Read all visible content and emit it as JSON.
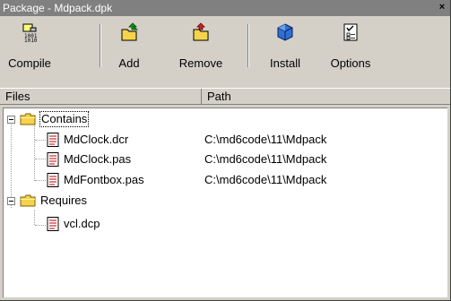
{
  "window": {
    "title": "Package - Mdpack.dpk",
    "close_glyph": "×"
  },
  "toolbar": {
    "compile_label": "Compile",
    "add_label": "Add",
    "remove_label": "Remove",
    "install_label": "Install",
    "options_label": "Options"
  },
  "columns": {
    "files": "Files",
    "path": "Path"
  },
  "tree": {
    "contains": {
      "label": "Contains",
      "files": [
        {
          "name": "MdClock.dcr",
          "path": "C:\\md6code\\11\\Mdpack"
        },
        {
          "name": "MdClock.pas",
          "path": "C:\\md6code\\11\\Mdpack"
        },
        {
          "name": "MdFontbox.pas",
          "path": "C:\\md6code\\11\\Mdpack"
        }
      ]
    },
    "requires": {
      "label": "Requires",
      "files": [
        {
          "name": "vcl.dcp",
          "path": ""
        }
      ]
    }
  },
  "colors": {
    "titlebar": "#808080",
    "face": "#d4d0c8",
    "folder": "#f5d34c"
  }
}
